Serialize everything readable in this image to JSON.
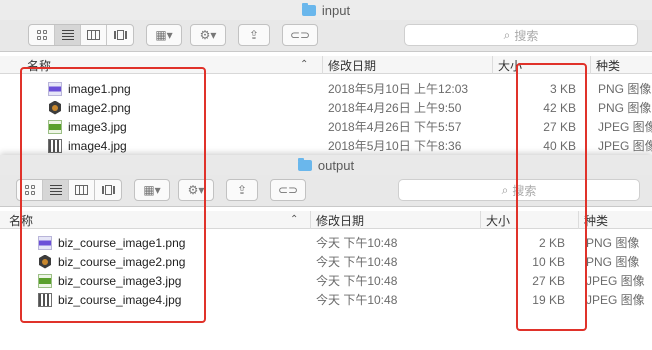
{
  "windows": {
    "input": {
      "title": "input",
      "search_placeholder": "搜索",
      "columns": {
        "name": "名称",
        "date": "修改日期",
        "size": "大小",
        "kind": "种类"
      },
      "files": [
        {
          "name": "image1.png",
          "date": "2018年5月10日 上午12:03",
          "size": "3 KB",
          "kind": "PNG 图像",
          "icon": "png-purple-icon"
        },
        {
          "name": "image2.png",
          "date": "2018年4月26日 上午9:50",
          "size": "42 KB",
          "kind": "PNG 图像",
          "icon": "png-hexagon-icon"
        },
        {
          "name": "image3.jpg",
          "date": "2018年4月26日 下午5:57",
          "size": "27 KB",
          "kind": "JPEG 图像",
          "icon": "jpg-green-icon"
        },
        {
          "name": "image4.jpg",
          "date": "2018年5月10日 下午8:36",
          "size": "40 KB",
          "kind": "JPEG 图像",
          "icon": "jpg-qrcode-icon"
        }
      ]
    },
    "output": {
      "title": "output",
      "search_placeholder": "搜索",
      "columns": {
        "name": "名称",
        "date": "修改日期",
        "size": "大小",
        "kind": "种类"
      },
      "files": [
        {
          "name": "biz_course_image1.png",
          "date": "今天 下午10:48",
          "size": "2 KB",
          "kind": "PNG 图像",
          "icon": "png-purple-icon"
        },
        {
          "name": "biz_course_image2.png",
          "date": "今天 下午10:48",
          "size": "10 KB",
          "kind": "PNG 图像",
          "icon": "png-hexagon-icon"
        },
        {
          "name": "biz_course_image3.jpg",
          "date": "今天 下午10:48",
          "size": "27 KB",
          "kind": "JPEG 图像",
          "icon": "jpg-green-icon"
        },
        {
          "name": "biz_course_image4.jpg",
          "date": "今天 下午10:48",
          "size": "19 KB",
          "kind": "JPEG 图像",
          "icon": "jpg-qrcode-icon"
        }
      ]
    }
  },
  "toolbar_icons": {
    "view_icon": "icon-view-icon",
    "list_view": "list-view-icon",
    "column_view": "column-view-icon",
    "cover_flow": "cover-flow-icon",
    "group": "group-icon",
    "action": "gear-icon",
    "share": "share-icon",
    "tag": "tag-icon",
    "search": "search-icon"
  },
  "colors": {
    "folder": "#6ab7ec",
    "annotation_red": "#e0322a",
    "toolbar_bg": "#e8e8e8"
  }
}
